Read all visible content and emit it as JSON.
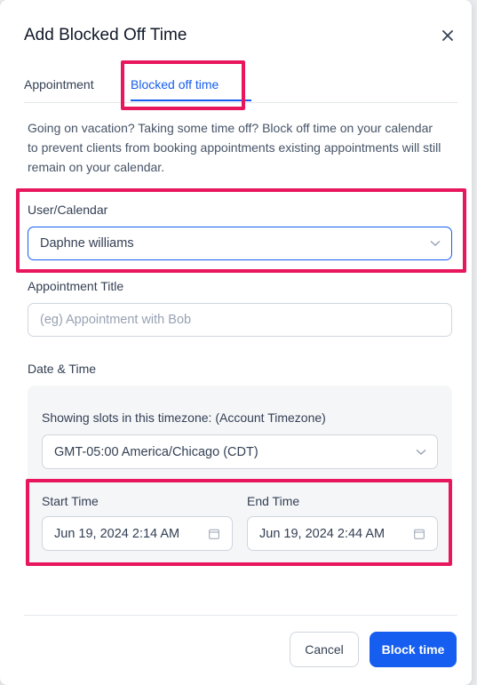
{
  "modal": {
    "title": "Add Blocked Off Time"
  },
  "tabs": [
    {
      "label": "Appointment",
      "active": false
    },
    {
      "label": "Blocked off time",
      "active": true
    }
  ],
  "description": "Going on vacation? Taking some time off? Block off time on your calendar to prevent clients from booking appointments existing appointments will still remain on your calendar.",
  "user_calendar": {
    "label": "User/Calendar",
    "value": "Daphne williams"
  },
  "appointment_title": {
    "label": "Appointment Title",
    "placeholder": "(eg) Appointment with Bob",
    "value": ""
  },
  "date_time": {
    "label": "Date & Time",
    "timezone_label": "Showing slots in this timezone: (Account Timezone)",
    "timezone_value": "GMT-05:00 America/Chicago (CDT)",
    "start_label": "Start Time",
    "start_value": "Jun 19, 2024 2:14 AM",
    "end_label": "End Time",
    "end_value": "Jun 19, 2024 2:44 AM"
  },
  "footer": {
    "cancel_label": "Cancel",
    "submit_label": "Block time"
  },
  "colors": {
    "accent": "#155eef",
    "highlight": "#e8175d"
  },
  "icons": [
    "close-icon",
    "chevron-down-icon",
    "calendar-icon"
  ]
}
